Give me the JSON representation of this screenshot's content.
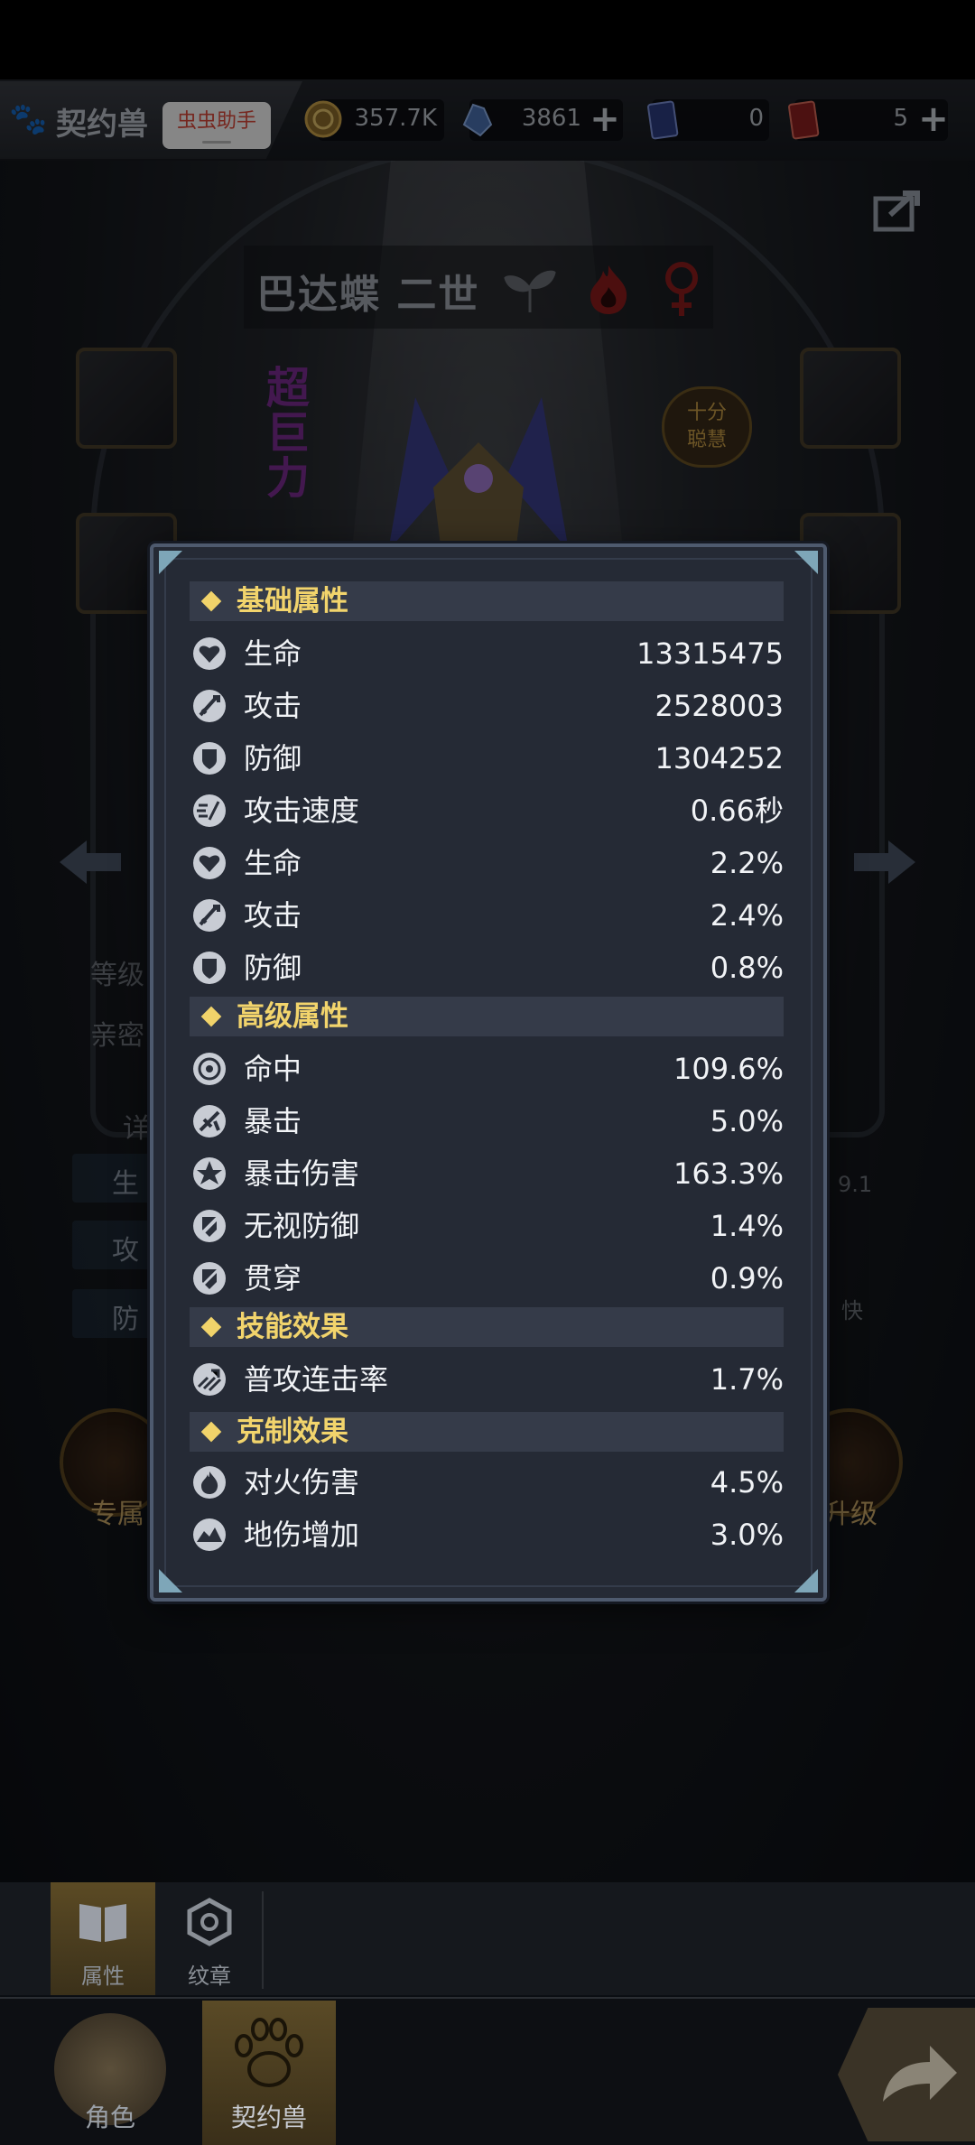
{
  "header": {
    "title": "契约兽",
    "helper_label": "虫虫助手",
    "resources": [
      {
        "icon": "coin-icon",
        "value": "357.7K"
      },
      {
        "icon": "crystal-icon",
        "value": "3861"
      },
      {
        "icon": "card-purple-icon",
        "value": "0"
      },
      {
        "icon": "card-red-icon",
        "value": "5"
      }
    ]
  },
  "pet": {
    "name": "巴达蝶 二世",
    "trait_badge": "超巨力",
    "personality_badge_line1": "十分",
    "personality_badge_line2": "聪慧"
  },
  "background_panel": {
    "level_label": "等级",
    "intimacy_label": "亲密",
    "details_label": "详",
    "stat_hp_short": "生",
    "stat_atk_short": "攻",
    "stat_def_short": "防",
    "right_value": "9.1",
    "right_speed": "快",
    "exclusive_label": "专属",
    "upgrade_label": "升级"
  },
  "stats_modal": {
    "sections": [
      {
        "title": "基础属性",
        "rows": [
          {
            "icon": "heart-icon",
            "label": "生命",
            "value": "13315475"
          },
          {
            "icon": "sword-icon",
            "label": "攻击",
            "value": "2528003"
          },
          {
            "icon": "shield-icon",
            "label": "防御",
            "value": "1304252"
          },
          {
            "icon": "speed-icon",
            "label": "攻击速度",
            "value": "0.66秒"
          },
          {
            "icon": "heart-icon",
            "label": "生命",
            "value": "2.2%"
          },
          {
            "icon": "sword-icon",
            "label": "攻击",
            "value": "2.4%"
          },
          {
            "icon": "shield-icon",
            "label": "防御",
            "value": "0.8%"
          }
        ]
      },
      {
        "title": "高级属性",
        "rows": [
          {
            "icon": "target-icon",
            "label": "命中",
            "value": "109.6%"
          },
          {
            "icon": "crit-icon",
            "label": "暴击",
            "value": "5.0%"
          },
          {
            "icon": "crit-damage-icon",
            "label": "暴击伤害",
            "value": "163.3%"
          },
          {
            "icon": "ignore-defense-icon",
            "label": "无视防御",
            "value": "1.4%"
          },
          {
            "icon": "pierce-icon",
            "label": "贯穿",
            "value": "0.9%"
          }
        ]
      },
      {
        "title": "技能效果",
        "rows": [
          {
            "icon": "combo-icon",
            "label": "普攻连击率",
            "value": "1.7%"
          }
        ]
      },
      {
        "title": "克制效果",
        "rows": [
          {
            "icon": "fire-icon",
            "label": "对火伤害",
            "value": "4.5%"
          },
          {
            "icon": "earth-icon",
            "label": "地伤增加",
            "value": "3.0%"
          }
        ]
      }
    ]
  },
  "subtabs": [
    {
      "label": "属性",
      "icon": "book-icon",
      "active": true
    },
    {
      "label": "纹章",
      "icon": "emblem-icon",
      "active": false
    }
  ],
  "nav": [
    {
      "label": "角色",
      "icon": "character-icon",
      "active": false
    },
    {
      "label": "契约兽",
      "icon": "paw-icon",
      "active": true
    }
  ],
  "colors": {
    "section_title": "#f2d46c",
    "modal_bg": "#252a35",
    "modal_border": "#4e5a6e",
    "active_tab": "#5b4a24"
  }
}
